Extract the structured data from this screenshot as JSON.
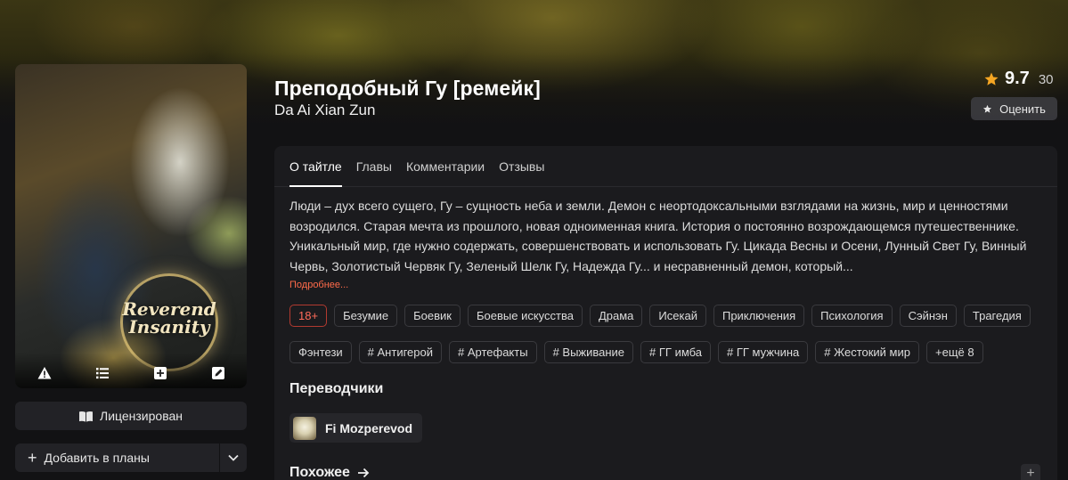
{
  "title": "Преподобный Гу [ремейк]",
  "author": "Da Ai Xian Zun",
  "cover": {
    "art_title": "Reverend Insanity",
    "icons": [
      "warning-icon",
      "list-icon",
      "plus-square-icon",
      "edit-icon"
    ]
  },
  "rating": {
    "value": "9.7",
    "count": "30",
    "rate_label": "Оценить"
  },
  "sidebar": {
    "licensed_label": "Лицензирован",
    "add_plans_label": "Добавить в планы"
  },
  "tabs": [
    {
      "label": "О тайтле",
      "active": true
    },
    {
      "label": "Главы",
      "active": false
    },
    {
      "label": "Комментарии",
      "active": false
    },
    {
      "label": "Отзывы",
      "active": false
    }
  ],
  "description": "Люди – дух всего сущего, Гу – сущность неба и земли. Демон с неортодоксальными взглядами на жизнь, мир и ценностями возродился. Старая мечта из прошлого, новая одноименная книга. История о постоянно возрождающемся путешественнике. Уникальный мир, где нужно содержать, совершенствовать и использовать Гу. Цикада Весны и Осени, Лунный Свет Гу, Винный Червь, Золотистый Червяк Гу, Зеленый Шелк Гу, Надежда Гу... и несравненный демон, который...",
  "more_label": "Подробнее...",
  "tags_row1": [
    "18+",
    "Безумие",
    "Боевик",
    "Боевые искусства",
    "Драма",
    "Исекай",
    "Приключения",
    "Психология",
    "Сэйнэн",
    "Трагедия"
  ],
  "tags_row2": [
    "Фэнтези",
    "# Антигерой",
    "# Артефакты",
    "# Выживание",
    "# ГГ имба",
    "# ГГ мужчина",
    "# Жестокий мир",
    "+ещё 8"
  ],
  "translators_heading": "Переводчики",
  "translator_name": "Fi Mozperevod",
  "similar_heading": "Похожее",
  "colors": {
    "accent": "#ff6b4a",
    "panel": "#1b1b1e",
    "background": "#121214",
    "star": "#f5a623"
  }
}
